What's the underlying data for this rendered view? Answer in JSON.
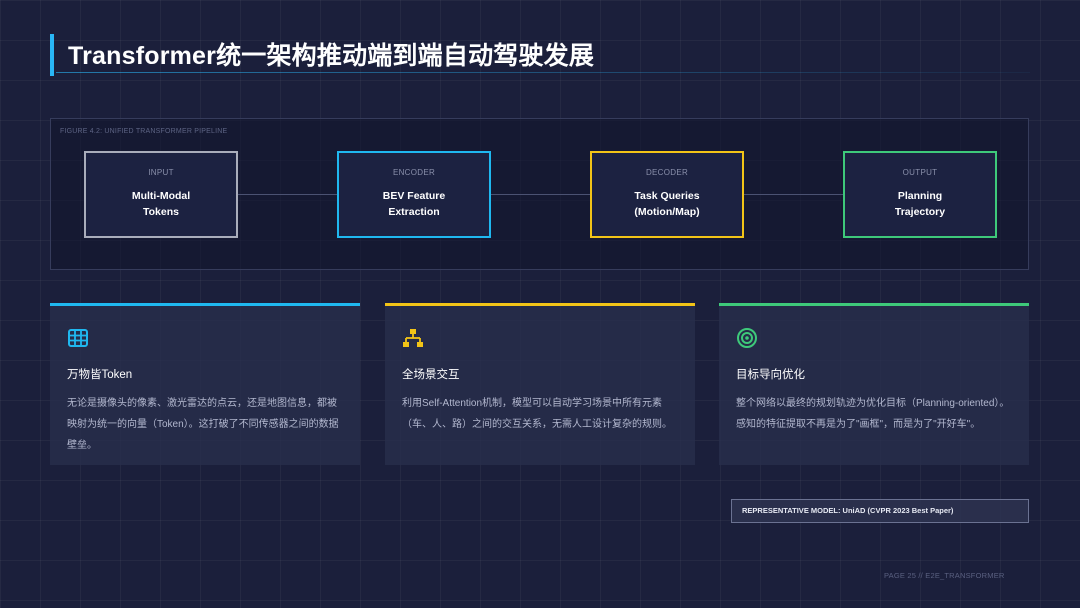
{
  "header": {
    "title": "Transformer统一架构推动端到端自动驾驶发展"
  },
  "pipeline": {
    "figure_label": "FIGURE 4.2: UNIFIED TRANSFORMER PIPELINE",
    "stages": [
      {
        "kicker": "INPUT",
        "name": "Multi-Modal\nTokens",
        "color": "#a9adbb"
      },
      {
        "kicker": "ENCODER",
        "name": "BEV Feature\nExtraction",
        "color": "#1fb8f0"
      },
      {
        "kicker": "DECODER",
        "name": "Task Queries\n(Motion/Map)",
        "color": "#f2c417"
      },
      {
        "kicker": "OUTPUT",
        "name": "Planning\nTrajectory",
        "color": "#3ec97a"
      }
    ]
  },
  "cards": [
    {
      "icon": "grid-icon",
      "color": "#1fb8f0",
      "title": "万物皆Token",
      "body": "无论是摄像头的像素、激光雷达的点云，还是地图信息，都被映射为统一的向量（Token）。这打破了不同传感器之间的数据壁垒。"
    },
    {
      "icon": "network-icon",
      "color": "#f2c417",
      "title": "全场景交互",
      "body": "利用Self-Attention机制，模型可以自动学习场景中所有元素（车、人、路）之间的交互关系，无需人工设计复杂的规则。"
    },
    {
      "icon": "target-icon",
      "color": "#3ec97a",
      "title": "目标导向优化",
      "body": "整个网络以最终的规划轨迹为优化目标（Planning-oriented）。感知的特征提取不再是为了\"画框\"，而是为了\"开好车\"。"
    }
  ],
  "model_note": "REPRESENTATIVE MODEL: UniAD (CVPR 2023 Best Paper)",
  "footer": "PAGE 25 // E2E_TRANSFORMER"
}
